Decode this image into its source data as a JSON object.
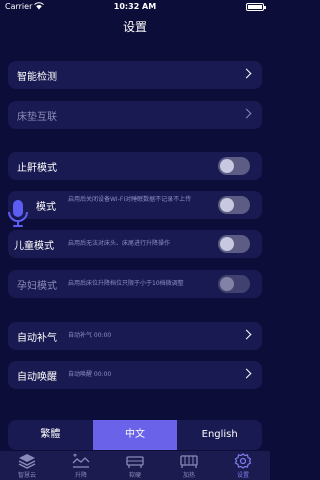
{
  "status_bar": {
    "carrier": "Carrier",
    "time": "10:32 AM"
  },
  "nav": {
    "title": "设置"
  },
  "rows": {
    "smart_detection": {
      "label": "智能检测"
    },
    "bed_link": {
      "label": "床垫互联"
    },
    "anti_snore": {
      "label": "止鼾模式",
      "on": false
    },
    "privacy": {
      "label": "模式",
      "desc": "启用后关闭设备WI-FI对睡眠数据不记录不上传",
      "on": false
    },
    "child": {
      "label": "儿童模式",
      "desc": "启用后无法对床头、床尾进行升降操作",
      "on": false
    },
    "pregnant": {
      "label": "孕妇模式",
      "desc": "启用后床位升降档位只限于小于10档微调整",
      "on": false
    },
    "auto_inflate": {
      "label": "自动补气",
      "desc": "自动补气 00:00"
    },
    "auto_wake": {
      "label": "自动唤醒",
      "desc": "自动唤醒 00:00"
    }
  },
  "language": {
    "options": [
      "繁體",
      "中文",
      "English"
    ],
    "selected": "中文"
  },
  "tabs": [
    {
      "label": "智慧云",
      "icon": "layers-icon"
    },
    {
      "label": "升降",
      "icon": "lift-icon"
    },
    {
      "label": "软硬",
      "icon": "firmness-icon"
    },
    {
      "label": "加热",
      "icon": "heating-icon"
    },
    {
      "label": "设置",
      "icon": "settings-gear-icon",
      "active": true
    }
  ],
  "colors": {
    "background": "#0d0d3a",
    "row": "#1a1a52",
    "accent": "#6a62e8",
    "mic": "#5b5ef0"
  }
}
